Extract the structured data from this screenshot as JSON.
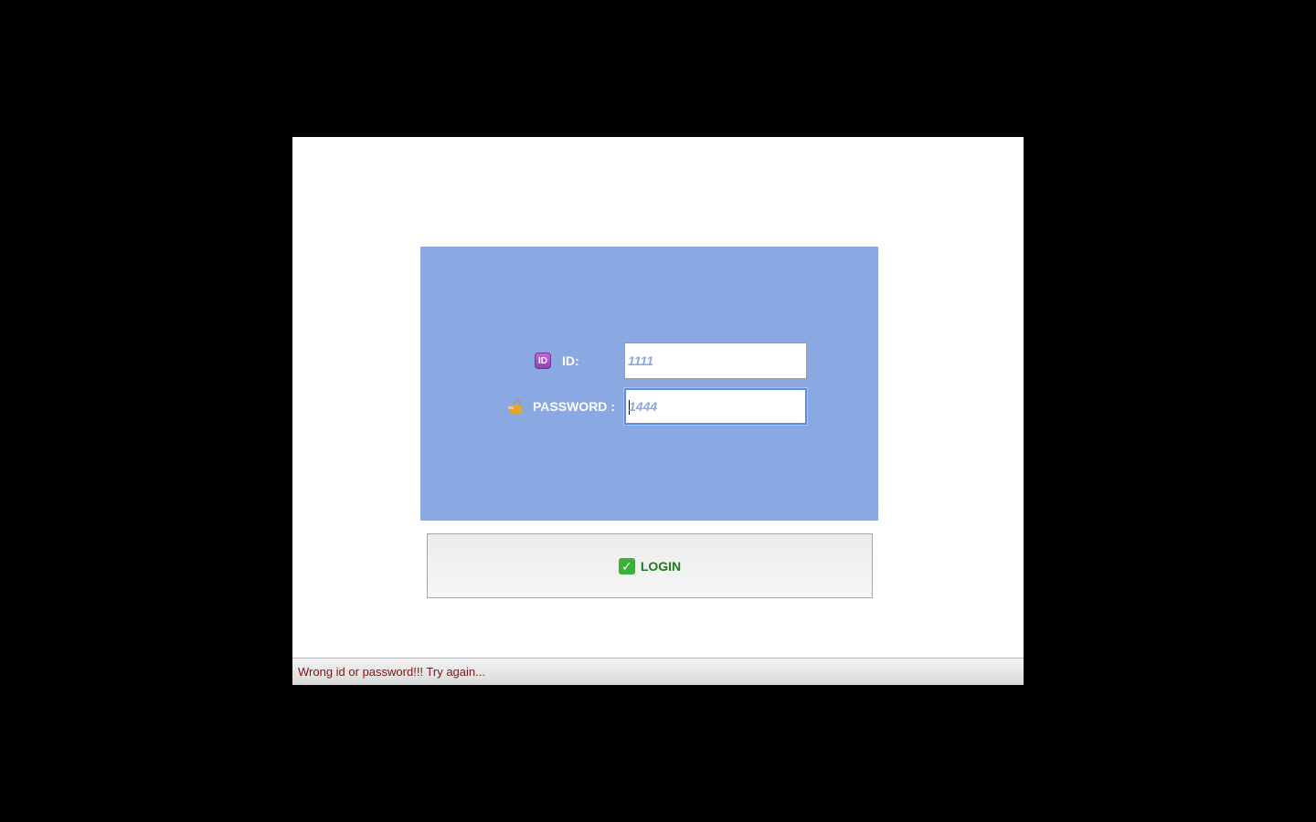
{
  "login_form": {
    "id_label": "ID:",
    "id_icon": "id-badge-icon",
    "id_value": "1111",
    "password_label": "PASSWORD :",
    "password_icon": "lock-with-key-icon",
    "password_value": "1444",
    "login_button_label": "LOGIN",
    "login_button_icon": "check-mark-icon"
  },
  "status_bar": {
    "message": "Wrong id or password!!! Try again..."
  },
  "colors": {
    "panel_background": "#8aa8e2",
    "field_text": "#8aa8e2",
    "login_label": "#1f7a1f",
    "status_text": "#8b1010",
    "focus_border": "#5b8de8"
  }
}
